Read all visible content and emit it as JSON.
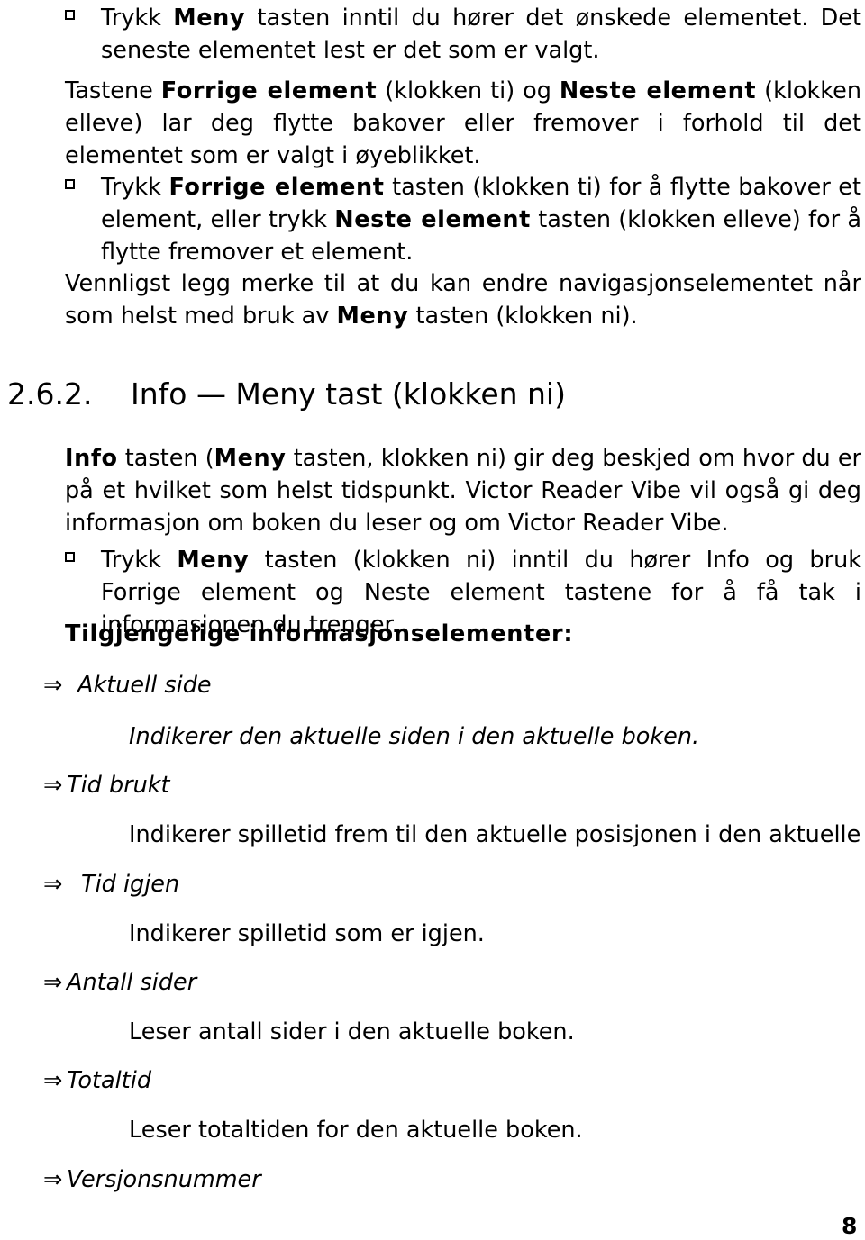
{
  "document": {
    "page_number": "8",
    "language": "no"
  },
  "blocks": {
    "bullet1": {
      "glyph": "hollow-square-bullet",
      "pre": "Trykk ",
      "bold": "Meny",
      "post": " tasten inntil du hører det ønskede elementet. Det seneste elementet lest er det som er valgt."
    },
    "para1": {
      "s1": "Tastene ",
      "b1": "Forrige element",
      "s2": " (klokken ti) og ",
      "b2": "Neste element",
      "s3": " (klokken elleve) lar deg flytte bakover eller fremover i forhold til det elementet som er valgt i øyeblikket."
    },
    "bullet2": {
      "glyph": "hollow-square-bullet",
      "s1": "Trykk ",
      "b1": "Forrige element",
      "s2": " tasten (klokken ti) for å flytte bakover et element, eller trykk ",
      "b2": "Neste element",
      "s3": " tasten (klokken elleve) for å flytte fremover et element."
    },
    "para2": {
      "s1": "Vennligst legg merke til at du kan endre navigasjonselementet når som helst med bruk av ",
      "b1": "Meny",
      "s2": " tasten (klokken ni)."
    },
    "heading": {
      "number": "2.6.2.",
      "title": "Info — Meny tast (klokken ni)"
    },
    "para3": {
      "b1": "Info",
      "s1": " tasten (",
      "b2": "Meny",
      "s2": " tasten, klokken ni) gir deg beskjed om hvor du er på et hvilket som helst tidspunkt. Victor Reader Vibe vil også gi deg informasjon om boken du leser og om Victor Reader Vibe."
    },
    "bullet3": {
      "glyph": "hollow-square-bullet",
      "s1": "Trykk ",
      "b1": "Meny",
      "s2": " tasten (klokken ni) inntil du hører Info og bruk Forrige element og Neste element tastene for å få tak i informasjonen du trenger."
    },
    "subheading": "Tilgjengelige informasjonselementer:"
  },
  "info_items": [
    {
      "arrow": "⇒",
      "label": "Aktuell side",
      "description": "Indikerer den aktuelle siden i den aktuelle boken.",
      "description_italic": true
    },
    {
      "arrow": "⇒",
      "label": "Tid brukt",
      "description": "Indikerer spilletid frem til den aktuelle posisjonen i den aktuelle boken.",
      "description_italic": false
    },
    {
      "arrow": "⇒",
      "label": "Tid igjen",
      "description": "Indikerer spilletid som er igjen.",
      "description_italic": false
    },
    {
      "arrow": "⇒",
      "label": "Antall sider",
      "description": "Leser antall sider i den aktuelle boken.",
      "description_italic": false
    },
    {
      "arrow": "⇒",
      "label": "Totaltid",
      "description": "Leser totaltiden for den aktuelle boken.",
      "description_italic": false
    },
    {
      "arrow": "⇒",
      "label": "Versjonsnummer",
      "description": null,
      "description_italic": false
    }
  ]
}
